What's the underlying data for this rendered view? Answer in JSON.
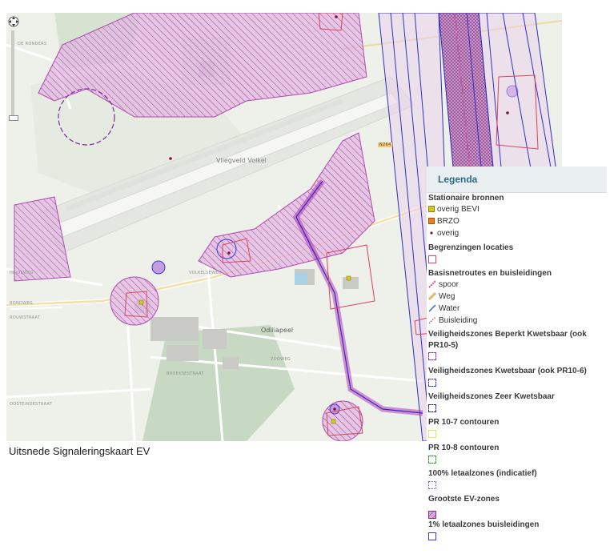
{
  "map": {
    "places": {
      "vliegveld": "Vliegveld Volkel",
      "odiliapeel": "Odiliapeel"
    },
    "roads": {
      "r1": "DE RONDERS",
      "r2": "HEIDEWEG",
      "r3": "RONDWEG",
      "r4": "VOLKELSEWEG",
      "r5": "ROUWSTRAAT",
      "r6": "OOSTEINDESTRAAT",
      "r7": "HOOGSTRAAT",
      "r8": "ZOOWEG",
      "r9": "BROEKSESTRAAT",
      "r10": "PEELWEG",
      "r11": "VOLKELSEWEG",
      "r12": "VOLKELSEWEG",
      "shield": "N264"
    },
    "controls": {
      "pan": "pan-control",
      "zoom": "zoom-slider"
    }
  },
  "caption": "Uitsnede Signaleringskaart EV",
  "legend": {
    "title": "Legenda",
    "stationary_title": "Stationaire bronnen",
    "stationary_items": [
      {
        "label": "overig BEVI",
        "icon": "yellow-square-icon",
        "color": "#d6c81a"
      },
      {
        "label": "BRZO",
        "icon": "orange-square-icon",
        "color": "#f07f1a"
      },
      {
        "label": "overig",
        "icon": "dot-icon",
        "color": "#8a1030"
      }
    ],
    "begrenzingen": "Begrenzingen locaties",
    "basisnet_title": "Basisnetroutes en buisleidingen",
    "basisnet_items": [
      {
        "label": "spoor",
        "icon": "rail-icon",
        "color": "#c05aa0"
      },
      {
        "label": "Weg",
        "icon": "road-icon",
        "color": "#e7b864"
      },
      {
        "label": "Water",
        "icon": "water-icon",
        "color": "#2f6fd1"
      },
      {
        "label": "Buisleiding",
        "icon": "pipeline-icon",
        "color": "#c0304a"
      }
    ],
    "zones": [
      {
        "label": "Veiligheidszones Beperkt Kwetsbaar (ook PR10-5)",
        "icon": "dashed-purple-square-icon",
        "color": "#9c2a9c"
      },
      {
        "label": "Veiligheidszones Kwetsbaar (ook PR10-6)",
        "icon": "dashed-blue-square-icon",
        "color": "#3a3ac8"
      },
      {
        "label": "Veiligheidszones Zeer Kwetsbaar",
        "icon": "dashed-navy-square-icon",
        "color": "#23238c"
      },
      {
        "label": "PR 10-7 contouren",
        "icon": "dashed-yellow-square-icon",
        "color": "#e8e23a"
      },
      {
        "label": "PR 10-8 contouren",
        "icon": "dashed-green-square-icon",
        "color": "#2a9a2a"
      },
      {
        "label": "100% letaalzones (indicatief)",
        "icon": "dotted-blue-square-icon",
        "color": "#4a5ad8"
      },
      {
        "label": "Grootste EV-zones",
        "icon": "hatched-square-icon",
        "color": "#8a2a8a"
      },
      {
        "label": "1% letaalzones buisleidingen",
        "icon": "blue-square-icon",
        "color": "#3a3ad8"
      }
    ]
  }
}
